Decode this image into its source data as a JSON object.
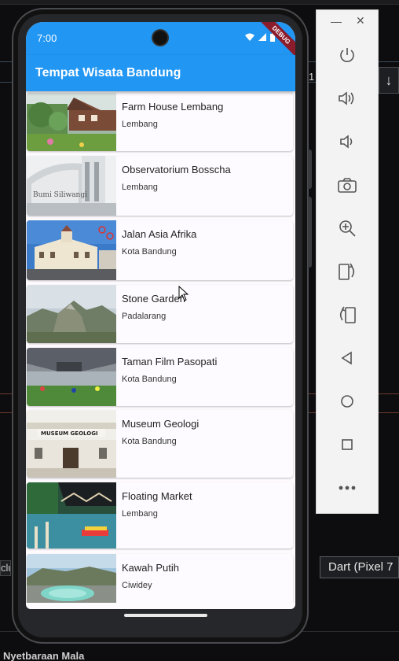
{
  "app": {
    "title": "Tempat Wisata Bandung",
    "status_time": "7:00",
    "debug_label": "DEBUG",
    "colors": {
      "primary": "#2196f3",
      "card_bg": "#fdfbff"
    }
  },
  "places": [
    {
      "name": "Farm House Lembang",
      "location": "Lembang"
    },
    {
      "name": "Observatorium Bosscha",
      "location": "Lembang"
    },
    {
      "name": "Jalan Asia Afrika",
      "location": "Kota Bandung"
    },
    {
      "name": "Stone Garden",
      "location": "Padalarang"
    },
    {
      "name": "Taman Film Pasopati",
      "location": "Kota Bandung"
    },
    {
      "name": "Museum Geologi",
      "location": "Kota Bandung"
    },
    {
      "name": "Floating Market",
      "location": "Lembang"
    },
    {
      "name": "Kawah Putih",
      "location": "Ciwidey"
    }
  ],
  "ide": {
    "device_selector": "Dart (Pixel 7",
    "left_box_text": "clu",
    "number_label": "1",
    "right_button_icon": "arrow-down-icon",
    "bottom_text": "Nyetbaraan Mala"
  },
  "emulator_toolbar": {
    "icons": [
      "power-icon",
      "volume-up-icon",
      "volume-down-icon",
      "camera-icon",
      "zoom-icon",
      "rotate-left-icon",
      "rotate-right-icon",
      "back-icon",
      "home-icon",
      "overview-icon",
      "more-icon"
    ]
  }
}
